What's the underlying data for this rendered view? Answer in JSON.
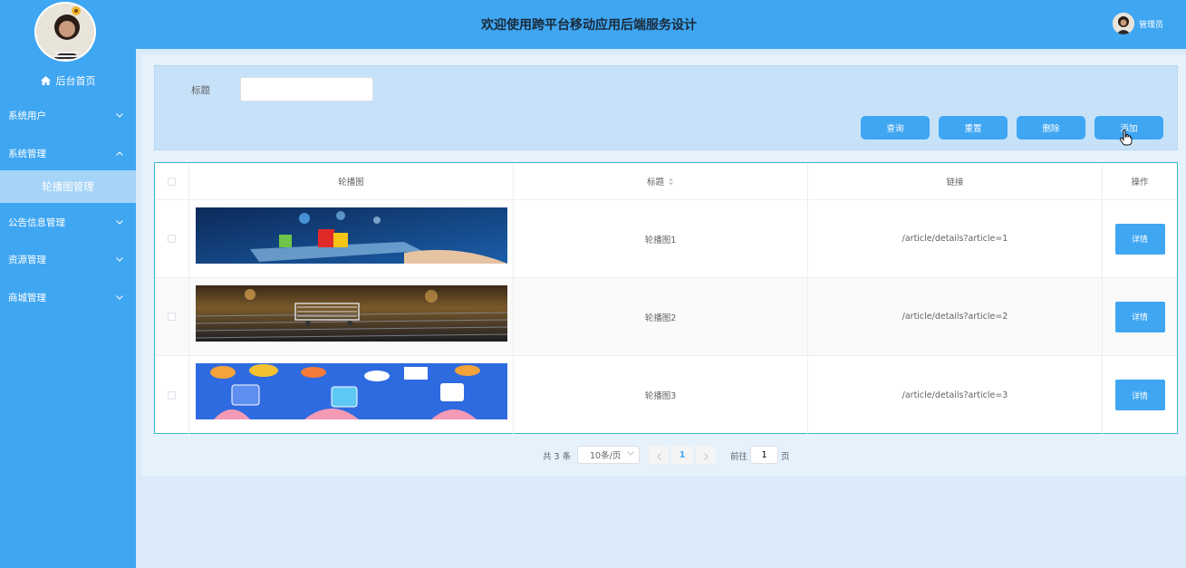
{
  "header": {
    "title": "欢迎使用跨平台移动应用后端服务设计",
    "user_name": "管理员"
  },
  "sidebar": {
    "home_label": "后台首页",
    "items": [
      {
        "label": "系统用户",
        "expanded": false
      },
      {
        "label": "系统管理",
        "expanded": true,
        "children": [
          {
            "label": "轮播图管理",
            "active": true
          }
        ]
      },
      {
        "label": "公告信息管理",
        "expanded": false
      },
      {
        "label": "资源管理",
        "expanded": false
      },
      {
        "label": "商城管理",
        "expanded": false
      }
    ]
  },
  "search": {
    "label": "标题",
    "value": ""
  },
  "actions": {
    "query": "查询",
    "reset": "重置",
    "delete": "删除",
    "add": "添加"
  },
  "table": {
    "columns": [
      "轮播图",
      "标题",
      "链接",
      "操作"
    ],
    "rows": [
      {
        "title": "轮播图1",
        "link": "/article/details?article=1",
        "action": "详情"
      },
      {
        "title": "轮播图2",
        "link": "/article/details?article=2",
        "action": "详情"
      },
      {
        "title": "轮播图3",
        "link": "/article/details?article=3",
        "action": "详情"
      }
    ]
  },
  "pagination": {
    "total": "共 3 条",
    "page_size": "10条/页",
    "current": "1",
    "goto_prefix": "前往",
    "goto_value": "1",
    "goto_suffix": "页"
  },
  "colors": {
    "primary": "#3fa6f2",
    "table_border": "#39b7d6",
    "active_menu": "#a6d4f7"
  }
}
